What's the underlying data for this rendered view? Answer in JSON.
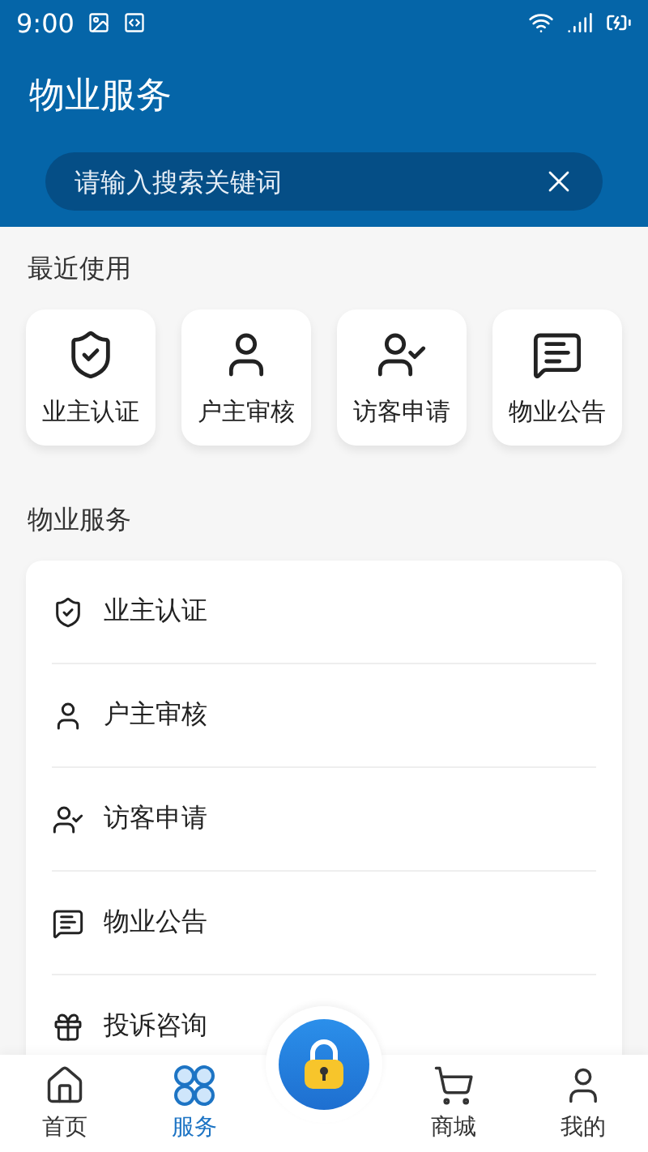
{
  "status_bar": {
    "time": "9:00"
  },
  "header": {
    "title": "物业服务"
  },
  "search": {
    "placeholder": "请输入搜索关键词"
  },
  "recent": {
    "title": "最近使用",
    "items": [
      {
        "kind": "shield",
        "label": "业主认证"
      },
      {
        "kind": "user",
        "label": "户主审核"
      },
      {
        "kind": "visitor",
        "label": "访客申请"
      },
      {
        "kind": "notice",
        "label": "物业公告"
      }
    ]
  },
  "services": {
    "title": "物业服务",
    "items": [
      {
        "kind": "shield",
        "label": "业主认证"
      },
      {
        "kind": "user",
        "label": "户主审核"
      },
      {
        "kind": "visitor",
        "label": "访客申请"
      },
      {
        "kind": "notice",
        "label": "物业公告"
      },
      {
        "kind": "gift",
        "label": "投诉咨询"
      }
    ]
  },
  "tab_bar": {
    "tabs": [
      {
        "kind": "home",
        "label": "首页",
        "selected": false
      },
      {
        "kind": "services",
        "label": "服务",
        "selected": true
      },
      {
        "kind": "lock"
      },
      {
        "kind": "cart",
        "label": "商城",
        "selected": false
      },
      {
        "kind": "user",
        "label": "我的",
        "selected": false
      }
    ]
  }
}
